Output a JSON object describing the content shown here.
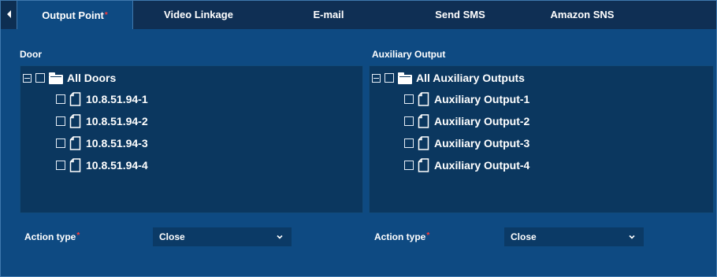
{
  "tabs": [
    {
      "label": "Output Point",
      "required": "*"
    },
    {
      "label": "Video Linkage"
    },
    {
      "label": "E-mail"
    },
    {
      "label": "Send SMS"
    },
    {
      "label": "Amazon SNS"
    }
  ],
  "door": {
    "label": "Door",
    "root": "All Doors",
    "items": [
      "10.8.51.94-1",
      "10.8.51.94-2",
      "10.8.51.94-3",
      "10.8.51.94-4"
    ]
  },
  "auxiliary": {
    "label": "Auxiliary Output",
    "root": "All Auxiliary Outputs",
    "items": [
      "Auxiliary Output-1",
      "Auxiliary Output-2",
      "Auxiliary Output-3",
      "Auxiliary Output-4"
    ]
  },
  "action_left": {
    "label": "Action type",
    "required": "*",
    "value": "Close"
  },
  "action_right": {
    "label": "Action type",
    "required": "*",
    "value": "Close"
  },
  "icons": {
    "scroll": "caret-left-icon",
    "collapse": "collapse-minus-icon",
    "folder": "folder-icon",
    "file": "file-icon",
    "dropdown": "chevron-down-icon"
  },
  "colors": {
    "required": "#ff3b3b",
    "panel": "#0e4a82",
    "tree_bg": "#0b375f"
  }
}
